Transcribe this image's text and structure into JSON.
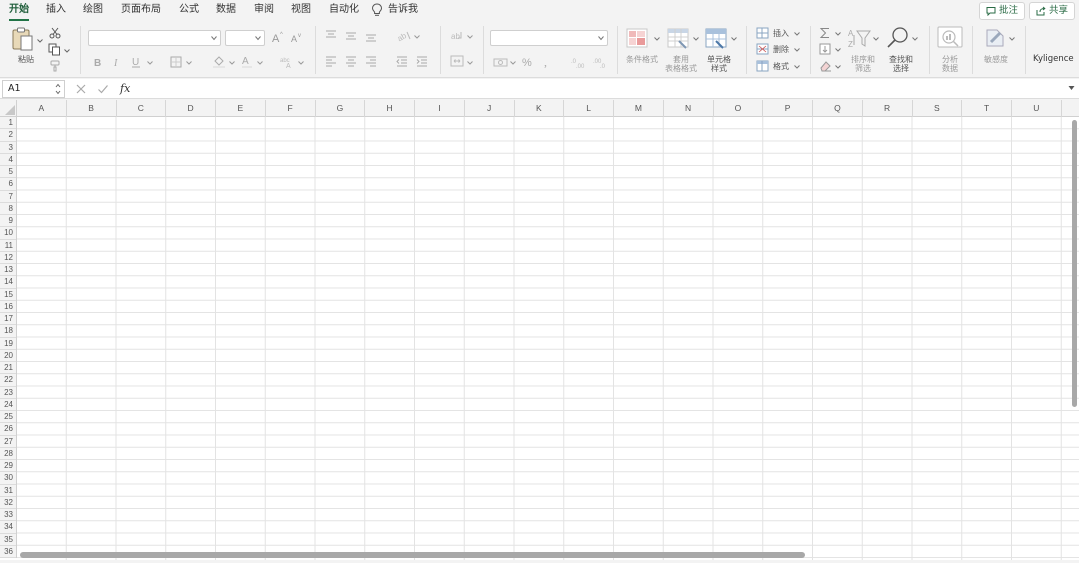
{
  "menu": {
    "tabs": [
      {
        "label": "开始",
        "active": true
      },
      {
        "label": "插入"
      },
      {
        "label": "绘图"
      },
      {
        "label": "页面布局"
      },
      {
        "label": "公式"
      },
      {
        "label": "数据"
      },
      {
        "label": "审阅"
      },
      {
        "label": "视图"
      },
      {
        "label": "自动化"
      }
    ],
    "tell_me": "告诉我",
    "comments_label": "批注",
    "share_label": "共享"
  },
  "ribbon": {
    "paste_label": "粘贴",
    "conditional_format_label": "条件格式",
    "table_format_label_1": "套用",
    "table_format_label_2": "表格格式",
    "cell_style_label_1": "单元格",
    "cell_style_label_2": "样式",
    "insert_label": "插入",
    "delete_label": "删除",
    "format_label": "格式",
    "sort_filter_label_1": "排序和",
    "sort_filter_label_2": "筛选",
    "find_select_label_1": "查找和",
    "find_select_label_2": "选择",
    "analyze_label_1": "分析",
    "analyze_label_2": "数据",
    "sensitivity_label": "敏感度",
    "kyligence_label": "Kyligence",
    "font_name_value": "",
    "font_size_value": "",
    "number_format_value": ""
  },
  "formula_bar": {
    "name_box": "A1",
    "fx_label": "fx",
    "value": ""
  },
  "sheet": {
    "columns": [
      "A",
      "B",
      "C",
      "D",
      "E",
      "F",
      "G",
      "H",
      "I",
      "J",
      "K",
      "L",
      "M",
      "N",
      "O",
      "P",
      "Q",
      "R",
      "S",
      "T",
      "U"
    ],
    "rows": [
      "1",
      "2",
      "3",
      "4",
      "5",
      "6",
      "7",
      "8",
      "9",
      "10",
      "11",
      "12",
      "13",
      "14",
      "15",
      "16",
      "17",
      "18",
      "19",
      "20",
      "21",
      "22",
      "23",
      "24",
      "25",
      "26",
      "27",
      "28",
      "29",
      "30",
      "31",
      "32",
      "33",
      "34",
      "35",
      "36"
    ],
    "accent_color": "#217346"
  }
}
